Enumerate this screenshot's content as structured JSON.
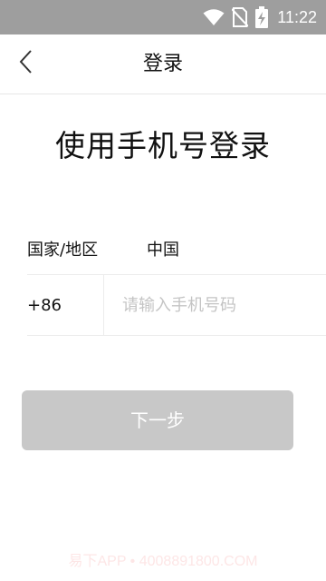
{
  "status_bar": {
    "time": "11:22",
    "icons": [
      "wifi-icon",
      "no-sim-icon",
      "battery-charging-icon"
    ],
    "background": "#9e9e9e"
  },
  "app_bar": {
    "title": "登录",
    "back_icon": "chevron-left-icon"
  },
  "main": {
    "heading": "使用手机号登录",
    "country_label": "国家/地区",
    "country_value": "中国",
    "country_code": "+86",
    "phone_placeholder": "请输入手机号码",
    "phone_value": "",
    "next_button": "下一步",
    "next_button_color": "#c8c8c8"
  },
  "watermark": "易下APP • 4008891800.COM"
}
